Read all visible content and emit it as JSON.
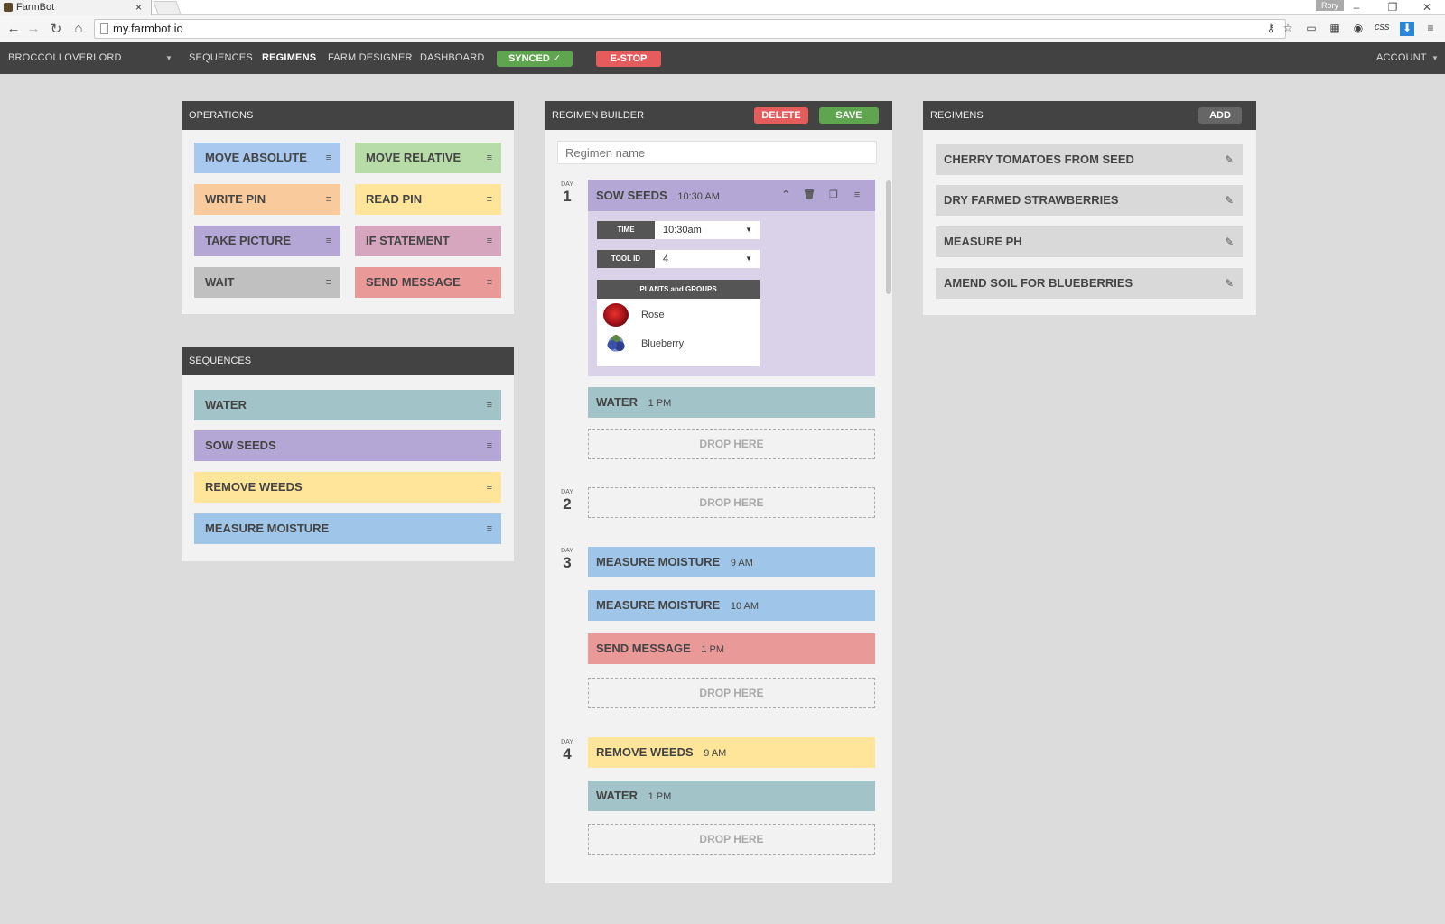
{
  "browser": {
    "tab_title": "FarmBot",
    "tab_close": "×",
    "user": "Rory",
    "url": "my.farmbot.io",
    "ext_css": "css"
  },
  "nav": {
    "bot_name": "BROCCOLI OVERLORD",
    "items": [
      "SEQUENCES",
      "REGIMENS",
      "FARM DESIGNER",
      "DASHBOARD"
    ],
    "active": "REGIMENS",
    "synced": "SYNCED ✓",
    "estop": "E-STOP",
    "account": "ACCOUNT"
  },
  "operations": {
    "title": "OPERATIONS",
    "items": [
      {
        "label": "MOVE ABSOLUTE",
        "color": "#a8c8f0"
      },
      {
        "label": "MOVE RELATIVE",
        "color": "#b7dca8"
      },
      {
        "label": "WRITE PIN",
        "color": "#f9cb9c"
      },
      {
        "label": "READ PIN",
        "color": "#ffe599"
      },
      {
        "label": "TAKE PICTURE",
        "color": "#b4a7d6"
      },
      {
        "label": "IF STATEMENT",
        "color": "#d5a6bd"
      },
      {
        "label": "WAIT",
        "color": "#c0c0c0"
      },
      {
        "label": "SEND MESSAGE",
        "color": "#ea9999"
      }
    ]
  },
  "sequences": {
    "title": "SEQUENCES",
    "items": [
      {
        "label": "WATER",
        "color": "#a2c4c9"
      },
      {
        "label": "SOW SEEDS",
        "color": "#b4a7d6"
      },
      {
        "label": "REMOVE WEEDS",
        "color": "#ffe599"
      },
      {
        "label": "MEASURE MOISTURE",
        "color": "#9fc5e8"
      }
    ]
  },
  "builder": {
    "title": "REGIMEN BUILDER",
    "delete_label": "DELETE",
    "save_label": "SAVE",
    "name_placeholder": "Regimen name",
    "day_word": "DAY",
    "drop_label": "DROP HERE",
    "days": [
      {
        "num": "1",
        "expanded": {
          "name": "SOW SEEDS",
          "time": "10:30 AM",
          "time_label": "TIME",
          "time_value": "10:30am",
          "tool_label": "TOOL ID",
          "tool_value": "4",
          "plants_header": "PLANTS and GROUPS",
          "plants": [
            "Rose",
            "Blueberry"
          ]
        },
        "items": [
          {
            "name": "WATER",
            "time": "1 PM"
          }
        ]
      },
      {
        "num": "2",
        "items": []
      },
      {
        "num": "3",
        "items": [
          {
            "name": "MEASURE MOISTURE",
            "time": "9 AM"
          },
          {
            "name": "MEASURE MOISTURE",
            "time": "10 AM"
          },
          {
            "name": "SEND MESSAGE",
            "time": "1 PM"
          }
        ]
      },
      {
        "num": "4",
        "items": [
          {
            "name": "REMOVE WEEDS",
            "time": "9 AM"
          },
          {
            "name": "WATER",
            "time": "1 PM"
          }
        ]
      }
    ]
  },
  "regimens": {
    "title": "REGIMENS",
    "add_label": "ADD",
    "items": [
      "CHERRY TOMATOES FROM SEED",
      "DRY FARMED STRAWBERRIES",
      "MEASURE PH",
      "AMEND SOIL FOR BLUEBERRIES"
    ]
  },
  "icons": {
    "drag": "≡",
    "caret": "▼",
    "collapse": "⌃",
    "trash": "🗑",
    "copy": "❐",
    "edit": "✎"
  }
}
